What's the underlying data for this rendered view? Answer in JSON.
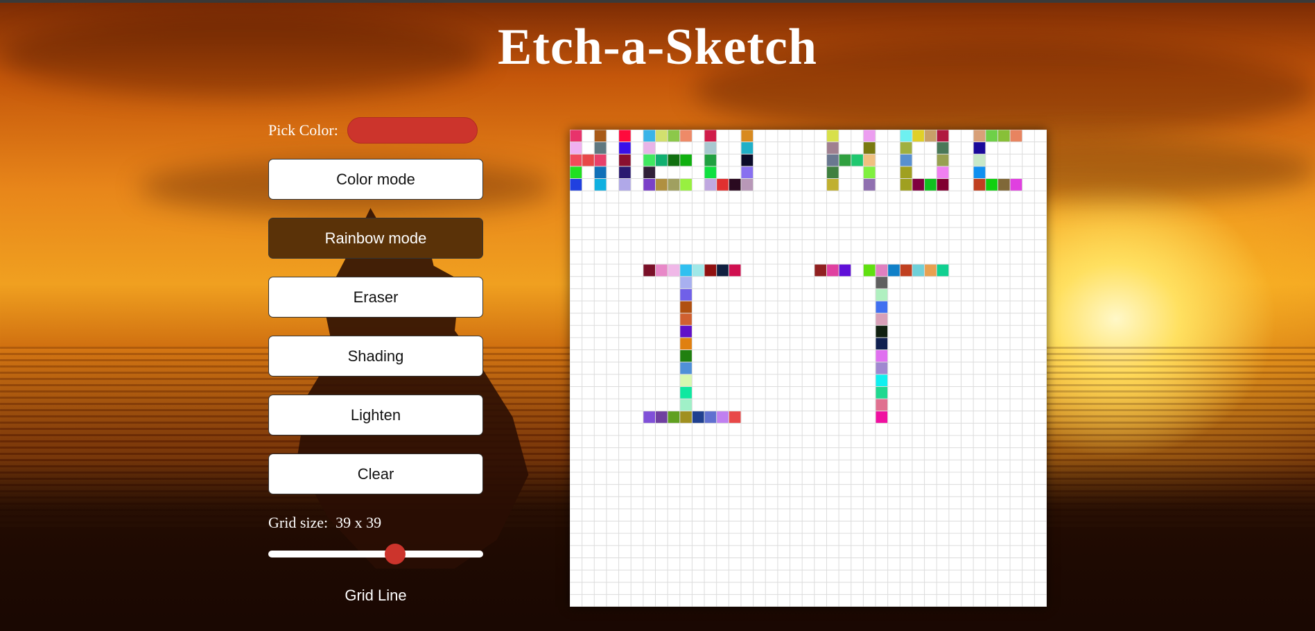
{
  "title": "Etch-a-Sketch",
  "controls": {
    "pick_color_label": "Pick Color:",
    "selected_color": "#cc342c",
    "buttons": [
      {
        "label": "Color mode",
        "active": false
      },
      {
        "label": "Rainbow mode",
        "active": true
      },
      {
        "label": "Eraser",
        "active": false
      },
      {
        "label": "Shading",
        "active": false
      },
      {
        "label": "Lighten",
        "active": false
      },
      {
        "label": "Clear",
        "active": false
      }
    ],
    "grid_size_label": "Grid size:",
    "grid_size_value": "39 x 39",
    "grid_size": 39,
    "slider_fraction": 0.59,
    "grid_line_label": "Grid Line"
  },
  "colors": {
    "accent": "#cc342c",
    "active_button": "#5a3208",
    "grid_line": "#dcdcdc"
  },
  "board": {
    "size": 39,
    "painted_cells": [
      [
        0,
        0,
        "#e8336b"
      ],
      [
        0,
        2,
        "#a85a18"
      ],
      [
        0,
        4,
        "#ff0a3c"
      ],
      [
        0,
        6,
        "#3ab4e8"
      ],
      [
        0,
        7,
        "#d2e06e"
      ],
      [
        0,
        8,
        "#8cc84a"
      ],
      [
        0,
        9,
        "#ee8a68"
      ],
      [
        0,
        11,
        "#d01c4a"
      ],
      [
        0,
        14,
        "#d88a20"
      ],
      [
        0,
        21,
        "#d8e04a"
      ],
      [
        0,
        24,
        "#ec9ef0"
      ],
      [
        0,
        27,
        "#6ef0f0"
      ],
      [
        0,
        28,
        "#e0d028"
      ],
      [
        0,
        29,
        "#c8a068"
      ],
      [
        0,
        30,
        "#b01840"
      ],
      [
        0,
        33,
        "#d8a078"
      ],
      [
        0,
        34,
        "#6ed048"
      ],
      [
        0,
        35,
        "#88c038"
      ],
      [
        0,
        36,
        "#e88460"
      ],
      [
        1,
        0,
        "#f0b0f0"
      ],
      [
        1,
        2,
        "#607880"
      ],
      [
        1,
        4,
        "#3a10e8"
      ],
      [
        1,
        6,
        "#e8b4e8"
      ],
      [
        1,
        11,
        "#a8c8d0"
      ],
      [
        1,
        14,
        "#20b0c8"
      ],
      [
        1,
        21,
        "#a08090"
      ],
      [
        1,
        24,
        "#7a7a10"
      ],
      [
        1,
        27,
        "#a0b040"
      ],
      [
        1,
        30,
        "#4a7858"
      ],
      [
        1,
        33,
        "#1a0a9a"
      ],
      [
        2,
        0,
        "#f04a5a"
      ],
      [
        2,
        1,
        "#e84848"
      ],
      [
        2,
        2,
        "#e8406a"
      ],
      [
        2,
        4,
        "#8a1030"
      ],
      [
        2,
        6,
        "#40e860"
      ],
      [
        2,
        7,
        "#10b070"
      ],
      [
        2,
        8,
        "#107010"
      ],
      [
        2,
        9,
        "#10b010"
      ],
      [
        2,
        11,
        "#20a040"
      ],
      [
        2,
        14,
        "#0a0a28"
      ],
      [
        2,
        21,
        "#6a7890"
      ],
      [
        2,
        22,
        "#30a040"
      ],
      [
        2,
        23,
        "#20c870"
      ],
      [
        2,
        24,
        "#f0c080"
      ],
      [
        2,
        27,
        "#5890d0"
      ],
      [
        2,
        30,
        "#98a050"
      ],
      [
        2,
        33,
        "#c8e8c8"
      ],
      [
        3,
        0,
        "#20e020"
      ],
      [
        3,
        2,
        "#1070b8"
      ],
      [
        3,
        4,
        "#2a1a70"
      ],
      [
        3,
        6,
        "#302038"
      ],
      [
        3,
        11,
        "#10e040"
      ],
      [
        3,
        14,
        "#8870f0"
      ],
      [
        3,
        21,
        "#408040"
      ],
      [
        3,
        24,
        "#80f040"
      ],
      [
        3,
        27,
        "#a0a020"
      ],
      [
        3,
        30,
        "#f080f0"
      ],
      [
        3,
        33,
        "#1090f0"
      ],
      [
        4,
        0,
        "#2040e0"
      ],
      [
        4,
        2,
        "#10b0e0"
      ],
      [
        4,
        4,
        "#b0a8e8"
      ],
      [
        4,
        6,
        "#7a40c8"
      ],
      [
        4,
        7,
        "#b09040"
      ],
      [
        4,
        8,
        "#a0a060"
      ],
      [
        4,
        9,
        "#98f040"
      ],
      [
        4,
        11,
        "#c0a8e0"
      ],
      [
        4,
        12,
        "#e03030"
      ],
      [
        4,
        13,
        "#2a0a20"
      ],
      [
        4,
        14,
        "#b898b8"
      ],
      [
        4,
        21,
        "#c0b030"
      ],
      [
        4,
        24,
        "#9070b0"
      ],
      [
        4,
        27,
        "#a0a020"
      ],
      [
        4,
        28,
        "#800040"
      ],
      [
        4,
        29,
        "#10c020"
      ],
      [
        4,
        30,
        "#800030"
      ],
      [
        4,
        33,
        "#c04020"
      ],
      [
        4,
        34,
        "#10d010"
      ],
      [
        4,
        35,
        "#806838"
      ],
      [
        4,
        36,
        "#e040e0"
      ],
      [
        11,
        6,
        "#7a1028"
      ],
      [
        11,
        7,
        "#e888c8"
      ],
      [
        11,
        8,
        "#f0b8e8"
      ],
      [
        11,
        9,
        "#30c0f0"
      ],
      [
        11,
        10,
        "#a0e8e8"
      ],
      [
        11,
        11,
        "#901010"
      ],
      [
        11,
        12,
        "#102040"
      ],
      [
        11,
        13,
        "#d01050"
      ],
      [
        12,
        9,
        "#a8b0f0"
      ],
      [
        13,
        9,
        "#7060e8"
      ],
      [
        14,
        9,
        "#b05010"
      ],
      [
        15,
        9,
        "#d06030"
      ],
      [
        16,
        9,
        "#6010c8"
      ],
      [
        17,
        9,
        "#e08010"
      ],
      [
        18,
        9,
        "#208010"
      ],
      [
        19,
        9,
        "#5090d8"
      ],
      [
        20,
        9,
        "#d8f8b0"
      ],
      [
        21,
        9,
        "#10e8a0"
      ],
      [
        22,
        9,
        "#a0f0c8"
      ],
      [
        23,
        6,
        "#8050d8"
      ],
      [
        23,
        7,
        "#7040a0"
      ],
      [
        23,
        8,
        "#60a020"
      ],
      [
        23,
        9,
        "#a09020"
      ],
      [
        23,
        10,
        "#204090"
      ],
      [
        23,
        11,
        "#6070d0"
      ],
      [
        23,
        12,
        "#c080f0"
      ],
      [
        23,
        13,
        "#e84848"
      ],
      [
        11,
        20,
        "#902020"
      ],
      [
        11,
        21,
        "#e040a0"
      ],
      [
        11,
        22,
        "#6010d8"
      ],
      [
        11,
        24,
        "#60e010"
      ],
      [
        11,
        25,
        "#e080c0"
      ],
      [
        11,
        26,
        "#1080c8"
      ],
      [
        11,
        27,
        "#c04020"
      ],
      [
        11,
        28,
        "#70d0d8"
      ],
      [
        11,
        29,
        "#e8a050"
      ],
      [
        11,
        30,
        "#10d090"
      ],
      [
        12,
        25,
        "#606060"
      ],
      [
        13,
        25,
        "#b0f0c0"
      ],
      [
        14,
        25,
        "#4070f0"
      ],
      [
        15,
        25,
        "#d8a0b8"
      ],
      [
        16,
        25,
        "#102010"
      ],
      [
        17,
        25,
        "#102050"
      ],
      [
        18,
        25,
        "#e070f0"
      ],
      [
        19,
        25,
        "#a088d0"
      ],
      [
        20,
        25,
        "#10f0f0"
      ],
      [
        21,
        25,
        "#20d890"
      ],
      [
        22,
        25,
        "#e07090"
      ],
      [
        23,
        25,
        "#f010a0"
      ]
    ]
  }
}
